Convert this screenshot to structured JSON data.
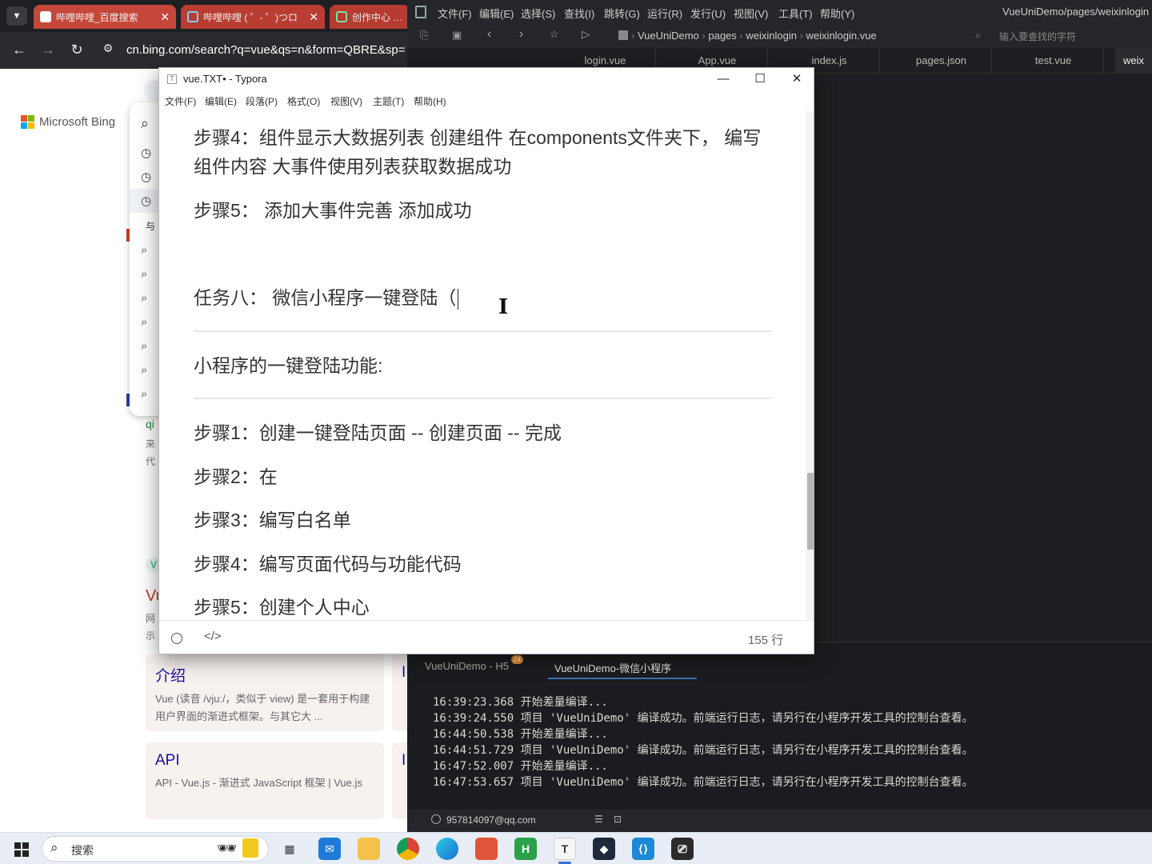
{
  "browser": {
    "tabs": [
      {
        "title": "哔哩哔哩_百度搜索",
        "active": false
      },
      {
        "title": "哔哩哔哩 ( ゜- ゜)つロ",
        "active": false
      },
      {
        "title": "创作中心 - 哔",
        "active": false
      }
    ],
    "url": "cn.bing.com/search?q=vue&qs=n&form=QBRE&sp=",
    "logo_text": "Microsoft Bing",
    "suggest_prefix": "与",
    "partial_texts": [
      "qi",
      "来",
      "代",
      "Vu",
      "网",
      "示",
      "I",
      "I"
    ],
    "cards": [
      {
        "title": "介绍",
        "desc": "Vue (读音 /vjuː/，类似于 view) 是一套用于构建用户界面的渐进式框架。与其它大 ..."
      },
      {
        "title": "API",
        "desc": "API - Vue.js - 渐进式 JavaScript 框架 | Vue.js"
      }
    ]
  },
  "ide": {
    "menu": [
      "文件(F)",
      "编辑(E)",
      "选择(S)",
      "查找(I)",
      "跳转(G)",
      "运行(R)",
      "发行(U)",
      "视图(V)",
      "工具(T)",
      "帮助(Y)"
    ],
    "window_title": "VueUniDemo/pages/weixinlogin",
    "breadcrumb": [
      "VueUniDemo",
      "pages",
      "weixinlogin",
      "weixinlogin.vue"
    ],
    "search_placeholder": "输入要查找的字符",
    "tabs": [
      "login.vue",
      "App.vue",
      "index.js",
      "pages.json",
      "test.vue",
      "weix"
    ],
    "console_tabs": [
      {
        "label": "VueUniDemo - H5",
        "badge": "24"
      },
      {
        "label": "VueUniDemo-微信小程序",
        "active": true
      }
    ],
    "log": [
      "16:39:23.368 开始差量编译...",
      "16:39:24.550 项目 'VueUniDemo' 编译成功。前端运行日志，请另行在小程序开发工具的控制台查看。",
      "16:44:50.538 开始差量编译...",
      "16:44:51.729 项目 'VueUniDemo' 编译成功。前端运行日志，请另行在小程序开发工具的控制台查看。",
      "16:47:52.007 开始差量编译...",
      "16:47:53.657 项目 'VueUniDemo' 编译成功。前端运行日志，请另行在小程序开发工具的控制台查看。"
    ],
    "status_user": "957814097@qq.com"
  },
  "typora": {
    "title": "vue.TXT• - Typora",
    "menu": [
      "文件(F)",
      "编辑(E)",
      "段落(P)",
      "格式(O)",
      "视图(V)",
      "主题(T)",
      "帮助(H)"
    ],
    "content": {
      "step4_line1": "步骤4：组件显示大数据列表 创建组件 在components文件夹下， 编写",
      "step4_line2": "组件内容 大事件使用列表获取数据成功",
      "step5": "步骤5： 添加大事件完善  添加成功",
      "task8": "任务八： 微信小程序一键登陆（",
      "section": "小程序的一键登陆功能:",
      "steps": [
        "步骤1：创建一键登陆页面  -- 创建页面 -- 完成",
        "步骤2：在",
        "步骤3：编写白名单",
        "步骤4：编写页面代码与功能代码",
        "步骤5：创建个人中心"
      ]
    },
    "line_count": "155 行"
  },
  "taskbar": {
    "search_label": "搜索",
    "apps": [
      "task-view",
      "mail",
      "file-explorer",
      "chrome",
      "edge",
      "app-store",
      "hbuilderx",
      "typora",
      "app-dark",
      "vscode",
      "remote"
    ]
  }
}
